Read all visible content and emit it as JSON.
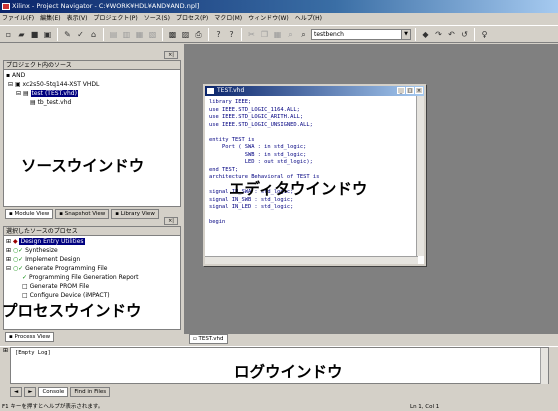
{
  "window": {
    "title": "Xilinx - Project Navigator - C:¥WORK¥HDL¥AND¥AND.npl]"
  },
  "menu": [
    "ファイル(F)",
    "編集(E)",
    "表示(V)",
    "プロジェクト(P)",
    "ソース(S)",
    "プロセス(P)",
    "マクロ(M)",
    "ウィンドウ(W)",
    "ヘルプ(H)"
  ],
  "toolbar": {
    "combo_value": "testbench"
  },
  "sources": {
    "title": "プロジェクト内のソース",
    "items": [
      "AND",
      "xc2s50-5tq144-XST VHDL",
      "test (TEST.vhd)",
      "tb_test.vhd"
    ],
    "tabs": [
      "Module View",
      "Snapshot View",
      "Library View"
    ]
  },
  "processes": {
    "title": "選択したソースのプロセス",
    "items": [
      "Design Entry Utilities",
      "Synthesize",
      "Implement Design",
      "Generate Programming File",
      "Programming File Generation Report",
      "Generate PROM File",
      "Configure Device (iMPACT)"
    ],
    "tab": "Process View"
  },
  "editor": {
    "title": "TEST.vhd",
    "code": "library IEEE;\nuse IEEE.STD_LOGIC_1164.ALL;\nuse IEEE.STD_LOGIC_ARITH.ALL;\nuse IEEE.STD_LOGIC_UNSIGNED.ALL;\n\nentity TEST is\n    Port ( SWA : in std_logic;\n           SWB : in std_logic;\n           LED : out std_logic);\nend TEST;\narchitecture Behavioral of TEST is\n\nsignal IN_SWA : std_logic;\nsignal IN_SWB : std_logic;\nsignal IN_LED : std_logic;\n\nbegin",
    "tab": "TEST.vhd"
  },
  "log": {
    "text": "[Empty Log]",
    "tabs": [
      "Console",
      "Find in Files"
    ]
  },
  "status": {
    "left": "F1 キーを押すとヘルプが表示されます。",
    "right": "Ln 1, Col 1"
  },
  "labels": {
    "source_window": "ソースウインドウ",
    "editor_window": "エディタウインドウ",
    "process_window": "プロセスウインドウ",
    "log_window": "ログウインドウ"
  }
}
